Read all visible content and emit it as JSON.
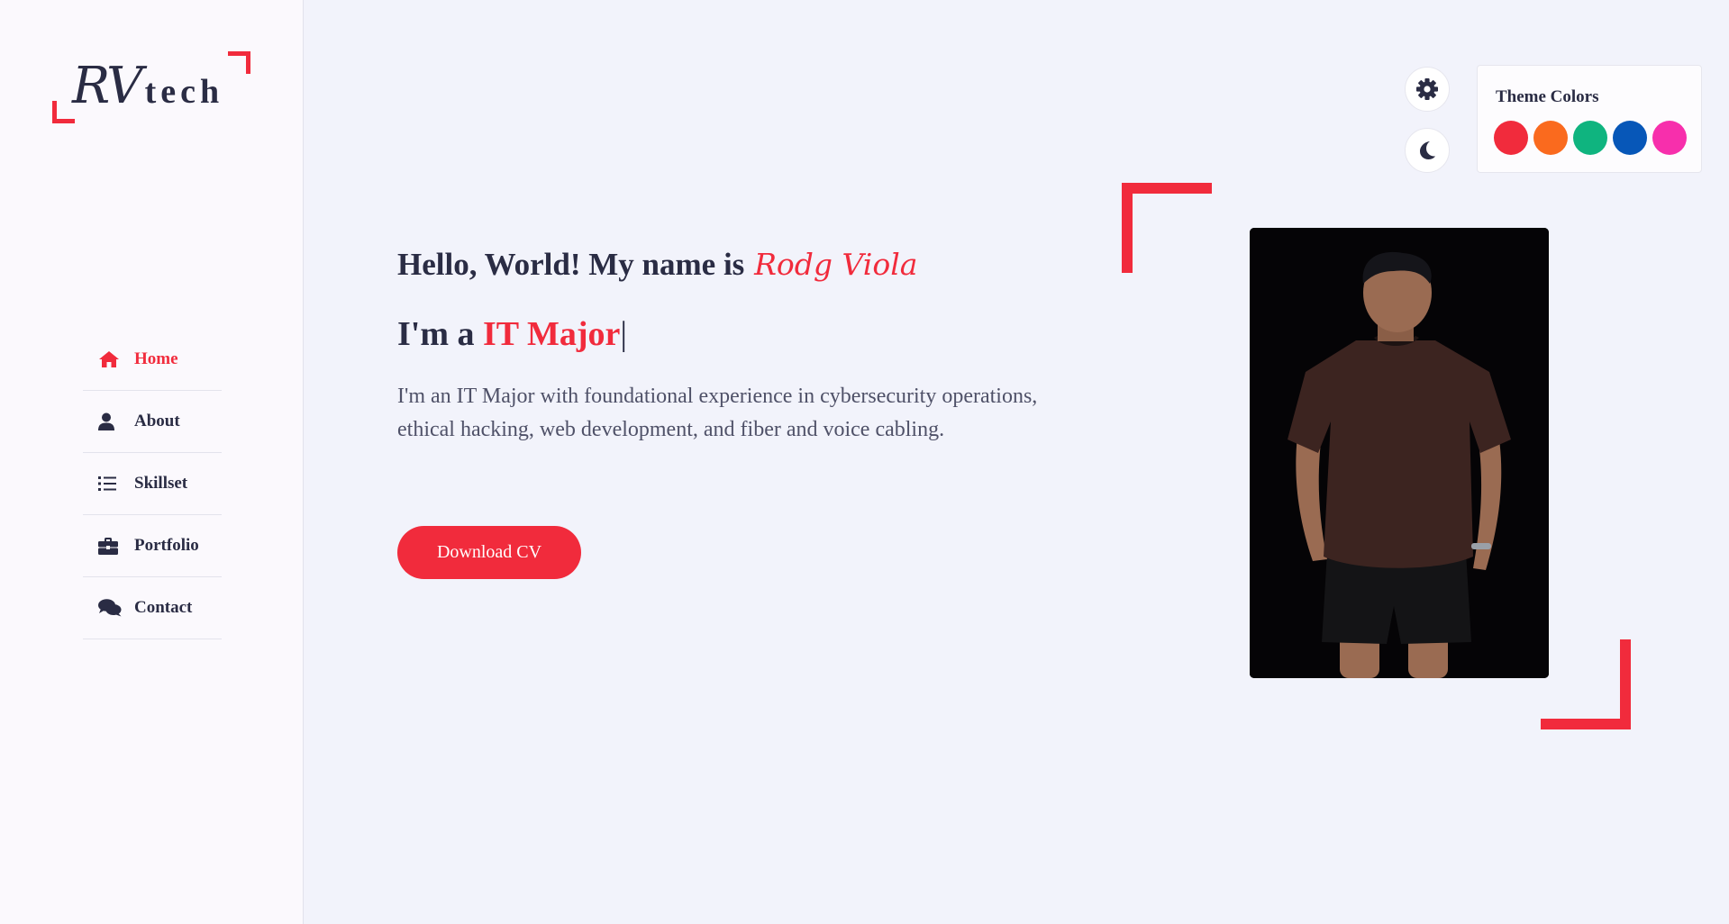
{
  "logo": {
    "text_main": "RV",
    "text_sub": "tech"
  },
  "nav": {
    "items": [
      {
        "label": "Home",
        "icon": "home-icon",
        "active": true
      },
      {
        "label": "About",
        "icon": "user-icon",
        "active": false
      },
      {
        "label": "Skillset",
        "icon": "list-icon",
        "active": false
      },
      {
        "label": "Portfolio",
        "icon": "briefcase-icon",
        "active": false
      },
      {
        "label": "Contact",
        "icon": "comments-icon",
        "active": false
      }
    ]
  },
  "hero": {
    "greeting": "Hello, World! My name is",
    "name": "Rodg Viola",
    "role_prefix": "I'm a",
    "role": "IT Major",
    "role_cursor": "|",
    "intro": "I'm an IT Major with foundational experience in cybersecurity operations, ethical hacking, web development, and fiber and voice cabling.",
    "cta_label": "Download CV"
  },
  "settings": {
    "gear_icon": "gear-icon",
    "theme_toggle_icon": "moon-icon"
  },
  "theme": {
    "title": "Theme Colors",
    "swatches": [
      "#f12b3c",
      "#fa6a1e",
      "#0fb47f",
      "#0757b8",
      "#f72fac"
    ]
  },
  "colors": {
    "accent": "#f12b3c",
    "text": "#2a2c44",
    "background": "#f2f3fb",
    "sidebar": "#fbf9fd"
  }
}
